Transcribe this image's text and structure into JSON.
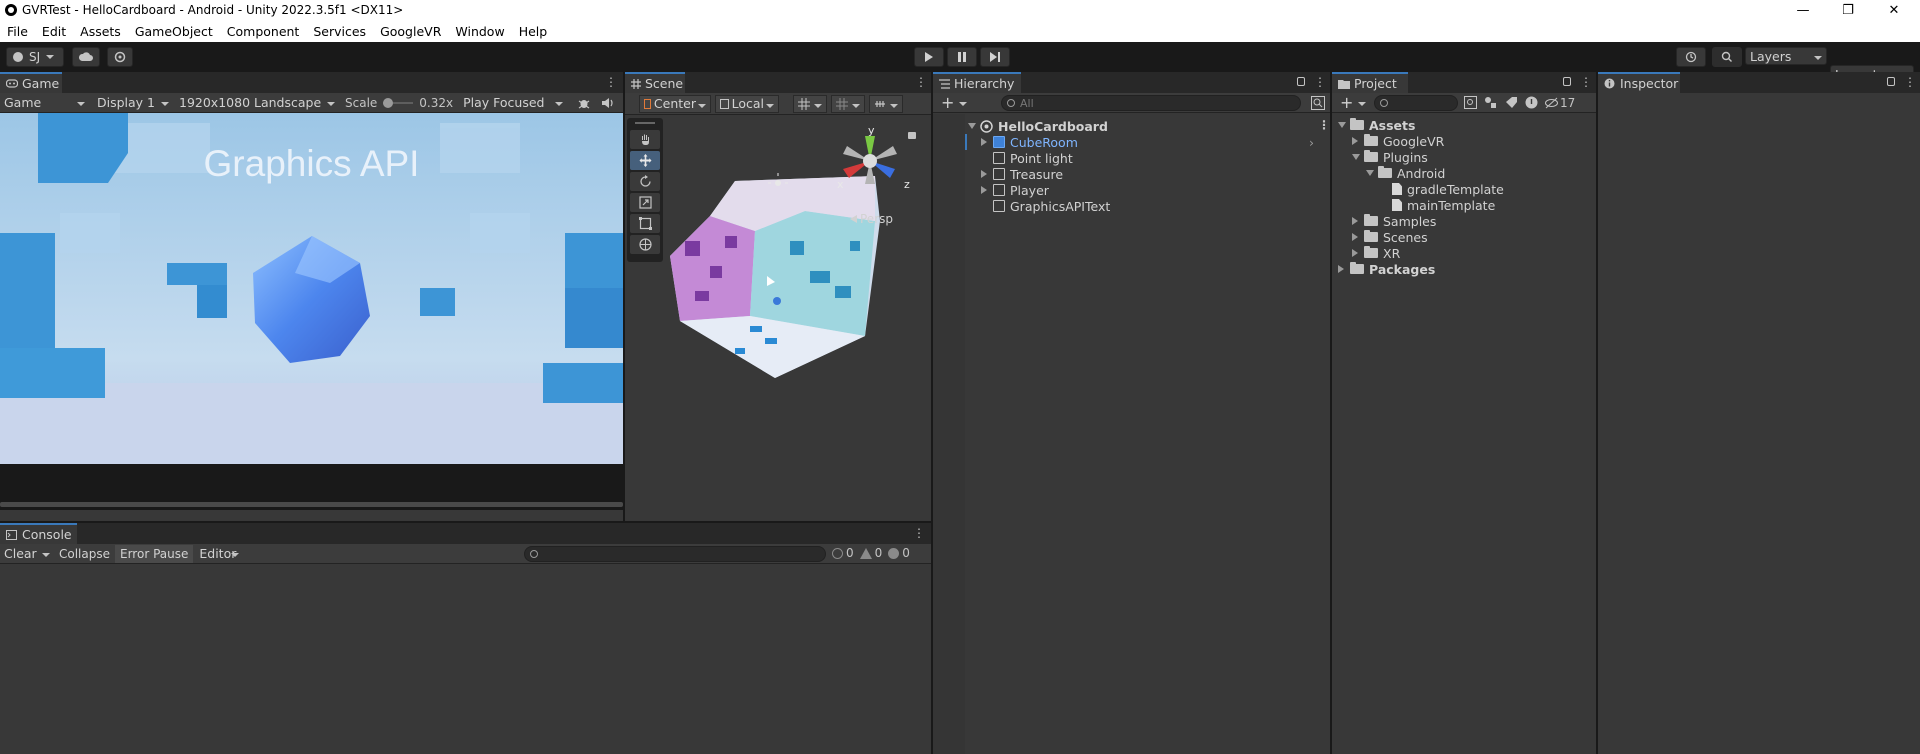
{
  "window": {
    "title": "GVRTest - HelloCardboard - Android - Unity 2022.3.5f1 <DX11>",
    "minimize_glyph": "—",
    "restore_glyph": "❐",
    "close_glyph": "✕"
  },
  "menu": [
    "File",
    "Edit",
    "Assets",
    "GameObject",
    "Component",
    "Services",
    "GoogleVR",
    "Window",
    "Help"
  ],
  "toolbar": {
    "account_label": "SJ",
    "layers_label": "Layers",
    "layout_label": "Layout"
  },
  "game": {
    "tab_label": "Game",
    "view_mode": "Game",
    "display": "Display 1",
    "resolution": "1920x1080 Landscape",
    "scale_label": "Scale",
    "scale_value": "0.32x",
    "play_mode": "Play Focused",
    "overlay_text": "Graphics API"
  },
  "scene": {
    "tab_label": "Scene",
    "pivot": "Center",
    "space": "Local",
    "persp_label": "Persp",
    "gizmo_axes": {
      "y": "y",
      "x": "x",
      "z": "z"
    }
  },
  "hierarchy": {
    "tab_label": "Hierarchy",
    "search_placeholder": "All",
    "root": "HelloCardboard",
    "items": [
      "CubeRoom",
      "Point light",
      "Treasure",
      "Player",
      "GraphicsAPIText"
    ]
  },
  "project": {
    "tab_label": "Project",
    "hidden_count": "17",
    "tree": {
      "assets": "Assets",
      "googlevr": "GoogleVR",
      "plugins": "Plugins",
      "android": "Android",
      "gradle": "gradleTemplate",
      "main": "mainTemplate",
      "samples": "Samples",
      "scenes": "Scenes",
      "xr": "XR",
      "packages": "Packages"
    }
  },
  "inspector": {
    "tab_label": "Inspector"
  },
  "console": {
    "tab_label": "Console",
    "clear_label": "Clear",
    "collapse_label": "Collapse",
    "error_pause_label": "Error Pause",
    "editor_label": "Editor",
    "log_count": "0",
    "warn_count": "0",
    "error_count": "0"
  },
  "colors": {
    "accent": "#3a79bb",
    "selection_text": "#7fb5ff",
    "panel_bg": "#383838",
    "dark_bg": "#191919"
  }
}
